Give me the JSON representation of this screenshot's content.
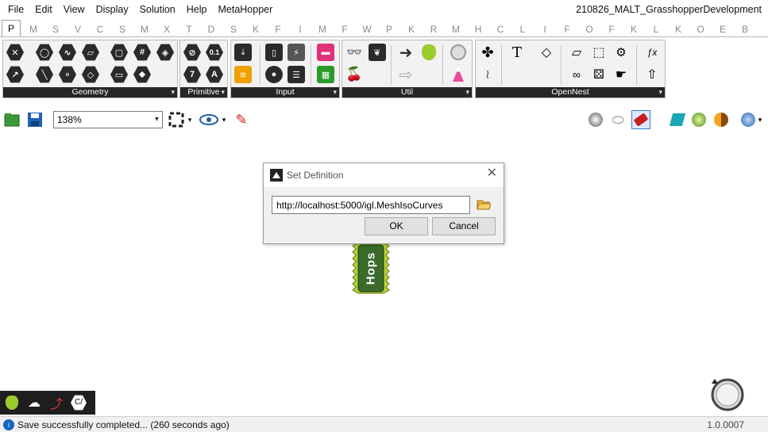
{
  "menu": {
    "items": [
      "File",
      "Edit",
      "View",
      "Display",
      "Solution",
      "Help",
      "MetaHopper"
    ],
    "document_title": "210826_MALT_GrasshopperDevelopment"
  },
  "tabs": [
    "P",
    "M",
    "S",
    "V",
    "C",
    "S",
    "M",
    "X",
    "T",
    "D",
    "S",
    "K",
    "F",
    "I",
    "M",
    "F",
    "W",
    "P",
    "K",
    "R",
    "M",
    "H",
    "C",
    "L",
    "I",
    "F",
    "O",
    "F",
    "K",
    "L",
    "K",
    "O",
    "E",
    "B"
  ],
  "active_tab_index": 0,
  "ribbon": {
    "panels": [
      "Geometry",
      "Primitive",
      "Input",
      "Util",
      "OpenNest"
    ],
    "primitive_labels": [
      "0.1",
      "7",
      "A"
    ]
  },
  "toolbar": {
    "zoom": "138%"
  },
  "dialog": {
    "title": "Set Definition",
    "url_value": "http://localhost:5000/igl.MeshIsoCurves",
    "ok_label": "OK",
    "cancel_label": "Cancel"
  },
  "component": {
    "label": "Hops"
  },
  "status": {
    "message": "Save successfully completed... (260 seconds ago)",
    "version": "1.0.0007"
  },
  "colors": {
    "ribbon_footer": "#262626",
    "hops_green": "#3b6b2a",
    "hops_zigzag": "#b5d334",
    "accent_blue": "#1565c0"
  }
}
